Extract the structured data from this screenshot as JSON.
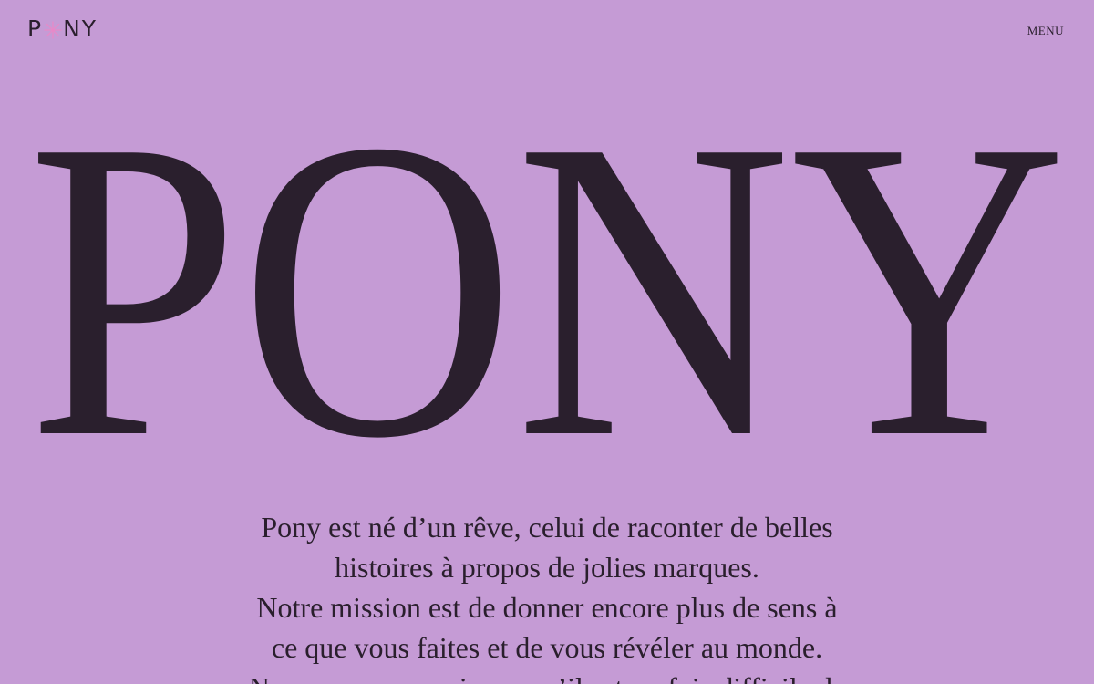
{
  "header": {
    "logo_prefix": "P",
    "logo_suffix": "NY",
    "menu_label": "MENU"
  },
  "hero": {
    "title": "PONY"
  },
  "intro": {
    "lines": [
      "Pony est né d’un rêve, celui de raconter de belles",
      "histoires à propos de jolies marques.",
      "Notre mission est de donner encore plus de sens à",
      "ce que vous faites et de vous révéler au monde.",
      "Nous avons conscience qu’il est parfois difficile de"
    ]
  },
  "colors": {
    "background": "#c59bd5",
    "text": "#2a1f2d",
    "logo_star": "#e889c8"
  },
  "icons": {
    "logo_mark": "asterisk-star-icon"
  }
}
